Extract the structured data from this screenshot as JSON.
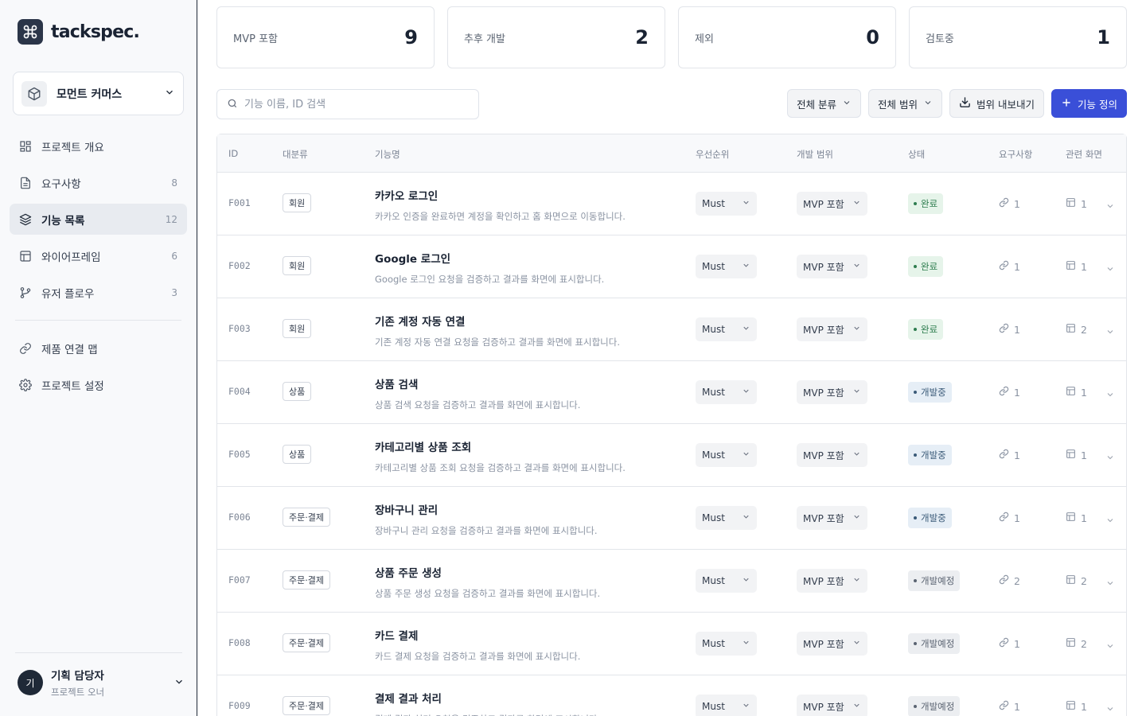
{
  "app": {
    "logo_text": "tackspec."
  },
  "project": {
    "name": "모먼트 커머스"
  },
  "nav": {
    "items": [
      {
        "label": "프로젝트 개요",
        "count": "",
        "icon": "dashboard-icon"
      },
      {
        "label": "요구사항",
        "count": "8",
        "icon": "document-icon"
      },
      {
        "label": "기능 목록",
        "count": "12",
        "icon": "layers-icon"
      },
      {
        "label": "와이어프레임",
        "count": "6",
        "icon": "layout-icon"
      },
      {
        "label": "유저 플로우",
        "count": "3",
        "icon": "branch-icon"
      }
    ],
    "secondary": [
      {
        "label": "제품 연결 맵",
        "icon": "link-icon"
      },
      {
        "label": "프로젝트 설정",
        "icon": "gear-icon"
      }
    ],
    "active_index": 2
  },
  "user": {
    "initial": "기",
    "name": "기획 담당자",
    "role": "프로젝트 오너"
  },
  "stats": [
    {
      "label": "MVP 포함",
      "value": "9"
    },
    {
      "label": "추후 개발",
      "value": "2"
    },
    {
      "label": "제외",
      "value": "0"
    },
    {
      "label": "검토중",
      "value": "1"
    }
  ],
  "toolbar": {
    "search_placeholder": "기능 이름, ID 검색",
    "category_filter": "전체 분류",
    "scope_filter": "전체 범위",
    "export_label": "범위 내보내기",
    "add_label": "기능 정의"
  },
  "colors": {
    "primary": "#3a4fd8",
    "status_done_bg": "#e6f4ea",
    "status_done_fg": "#2e7d4f",
    "status_dev_bg": "#e6eef6",
    "status_dev_fg": "#3a5a78",
    "status_planned_bg": "#eceef1",
    "status_planned_fg": "#5b6472"
  },
  "table": {
    "headers": {
      "id": "ID",
      "category": "대분류",
      "name": "기능명",
      "priority": "우선순위",
      "scope": "개발 범위",
      "status": "상태",
      "requirements": "요구사항",
      "screens": "관련 화면"
    },
    "rows": [
      {
        "id": "F001",
        "category": "회원",
        "name": "카카오 로그인",
        "desc": "카카오 인증을 완료하면 계정을 확인하고 홈 화면으로 이동합니다.",
        "priority": "Must",
        "scope": "MVP 포함",
        "status": "완료",
        "status_kind": "done",
        "req": "1",
        "screens": "1"
      },
      {
        "id": "F002",
        "category": "회원",
        "name": "Google 로그인",
        "desc": "Google 로그인 요청을 검증하고 결과를 화면에 표시합니다.",
        "priority": "Must",
        "scope": "MVP 포함",
        "status": "완료",
        "status_kind": "done",
        "req": "1",
        "screens": "1"
      },
      {
        "id": "F003",
        "category": "회원",
        "name": "기존 계정 자동 연결",
        "desc": "기존 계정 자동 연결 요청을 검증하고 결과를 화면에 표시합니다.",
        "priority": "Must",
        "scope": "MVP 포함",
        "status": "완료",
        "status_kind": "done",
        "req": "1",
        "screens": "2"
      },
      {
        "id": "F004",
        "category": "상품",
        "name": "상품 검색",
        "desc": "상품 검색 요청을 검증하고 결과를 화면에 표시합니다.",
        "priority": "Must",
        "scope": "MVP 포함",
        "status": "개발중",
        "status_kind": "dev",
        "req": "1",
        "screens": "1"
      },
      {
        "id": "F005",
        "category": "상품",
        "name": "카테고리별 상품 조회",
        "desc": "카테고리별 상품 조회 요청을 검증하고 결과를 화면에 표시합니다.",
        "priority": "Must",
        "scope": "MVP 포함",
        "status": "개발중",
        "status_kind": "dev",
        "req": "1",
        "screens": "1"
      },
      {
        "id": "F006",
        "category": "주문·결제",
        "name": "장바구니 관리",
        "desc": "장바구니 관리 요청을 검증하고 결과를 화면에 표시합니다.",
        "priority": "Must",
        "scope": "MVP 포함",
        "status": "개발중",
        "status_kind": "dev",
        "req": "1",
        "screens": "1"
      },
      {
        "id": "F007",
        "category": "주문·결제",
        "name": "상품 주문 생성",
        "desc": "상품 주문 생성 요청을 검증하고 결과를 화면에 표시합니다.",
        "priority": "Must",
        "scope": "MVP 포함",
        "status": "개발예정",
        "status_kind": "planned",
        "req": "2",
        "screens": "2"
      },
      {
        "id": "F008",
        "category": "주문·결제",
        "name": "카드 결제",
        "desc": "카드 결제 요청을 검증하고 결과를 화면에 표시합니다.",
        "priority": "Must",
        "scope": "MVP 포함",
        "status": "개발예정",
        "status_kind": "planned",
        "req": "1",
        "screens": "2"
      },
      {
        "id": "F009",
        "category": "주문·결제",
        "name": "결제 결과 처리",
        "desc": "결제 결과 처리 요청을 검증하고 결과를 화면에 표시합니다.",
        "priority": "Must",
        "scope": "MVP 포함",
        "status": "개발예정",
        "status_kind": "planned",
        "req": "1",
        "screens": "1"
      }
    ]
  }
}
